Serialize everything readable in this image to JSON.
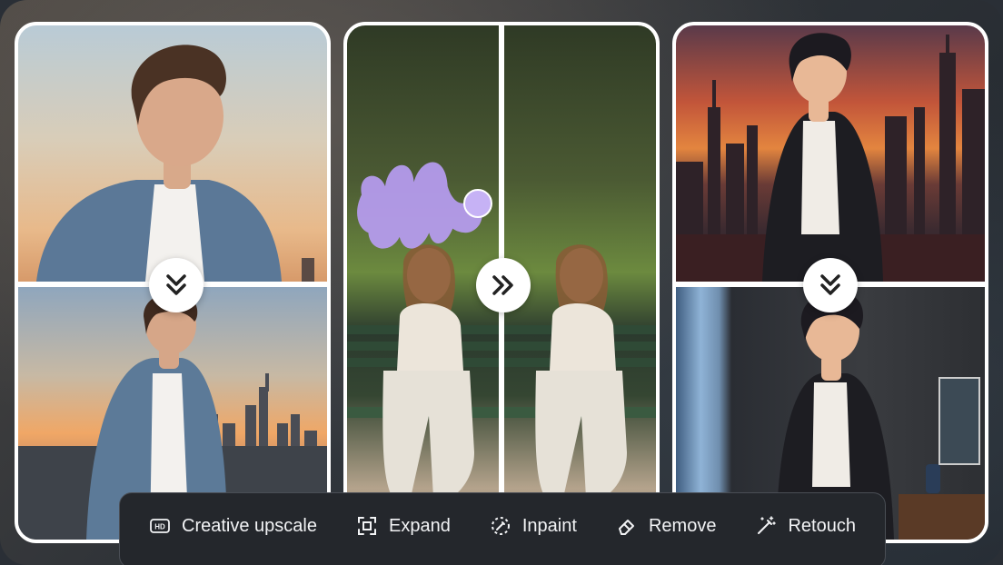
{
  "toolbar": {
    "items": [
      {
        "label": "Creative upscale",
        "icon": "hd-icon"
      },
      {
        "label": "Expand",
        "icon": "expand-icon"
      },
      {
        "label": "Inpaint",
        "icon": "inpaint-icon"
      },
      {
        "label": "Remove",
        "icon": "eraser-icon"
      },
      {
        "label": "Retouch",
        "icon": "magic-wand-icon"
      }
    ]
  },
  "colors": {
    "accent_brush": "#b79cf2",
    "toolbar_bg": "#24272c",
    "toolbar_text": "#f2f3f5"
  }
}
